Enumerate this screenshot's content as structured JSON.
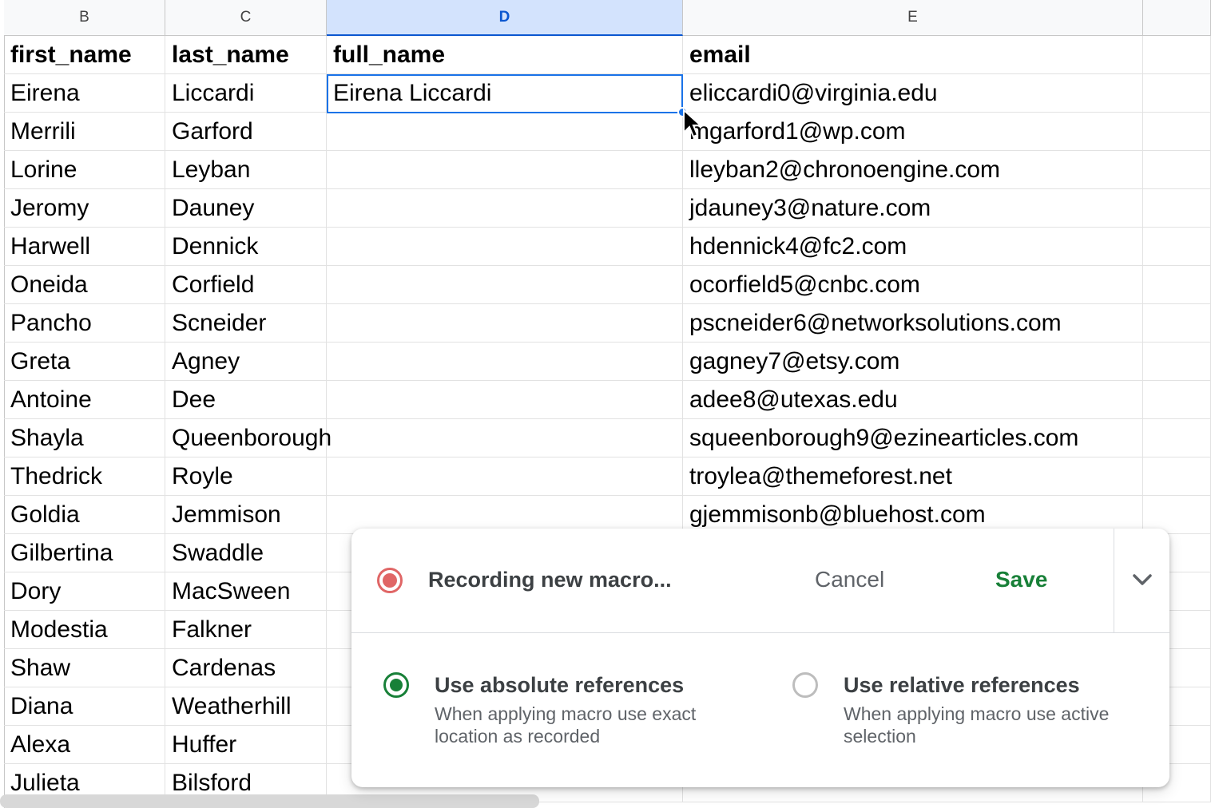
{
  "columns": [
    {
      "letter": "B",
      "selected": false
    },
    {
      "letter": "C",
      "selected": false
    },
    {
      "letter": "D",
      "selected": true
    },
    {
      "letter": "E",
      "selected": false
    }
  ],
  "header_row": [
    "first_name",
    "last_name",
    "full_name",
    "email"
  ],
  "rows": [
    [
      "Eirena",
      "Liccardi",
      "Eirena Liccardi",
      "eliccardi0@virginia.edu"
    ],
    [
      "Merrili",
      "Garford",
      "",
      "mgarford1@wp.com"
    ],
    [
      "Lorine",
      "Leyban",
      "",
      "lleyban2@chronoengine.com"
    ],
    [
      "Jeromy",
      "Dauney",
      "",
      "jdauney3@nature.com"
    ],
    [
      "Harwell",
      "Dennick",
      "",
      "hdennick4@fc2.com"
    ],
    [
      "Oneida",
      "Corfield",
      "",
      "ocorfield5@cnbc.com"
    ],
    [
      "Pancho",
      "Scneider",
      "",
      "pscneider6@networksolutions.com"
    ],
    [
      "Greta",
      "Agney",
      "",
      "gagney7@etsy.com"
    ],
    [
      "Antoine",
      "Dee",
      "",
      "adee8@utexas.edu"
    ],
    [
      "Shayla",
      "Queenborough",
      "",
      "squeenborough9@ezinearticles.com"
    ],
    [
      "Thedrick",
      "Royle",
      "",
      "troylea@themeforest.net"
    ],
    [
      "Goldia",
      "Jemmison",
      "",
      "gjemmisonb@bluehost.com"
    ],
    [
      "Gilbertina",
      "Swaddle",
      "",
      ""
    ],
    [
      "Dory",
      "MacSween",
      "",
      ""
    ],
    [
      "Modestia",
      "Falkner",
      "",
      ""
    ],
    [
      "Shaw",
      "Cardenas",
      "",
      ""
    ],
    [
      "Diana",
      "Weatherhill",
      "",
      ""
    ],
    [
      "Alexa",
      "Huffer",
      "",
      ""
    ],
    [
      "Julieta",
      "Bilsford",
      "",
      ""
    ]
  ],
  "active_cell": {
    "column": "D",
    "value": "Eirena Liccardi"
  },
  "macro_panel": {
    "status": "Recording new macro...",
    "cancel_label": "Cancel",
    "save_label": "Save",
    "options": [
      {
        "title": "Use absolute references",
        "description": "When applying macro use exact location as recorded",
        "selected": true
      },
      {
        "title": "Use relative references",
        "description": "When applying macro use active selection",
        "selected": false
      }
    ]
  },
  "colors": {
    "accent": "#1a73e8",
    "save": "#188038",
    "record": "#e06666"
  }
}
